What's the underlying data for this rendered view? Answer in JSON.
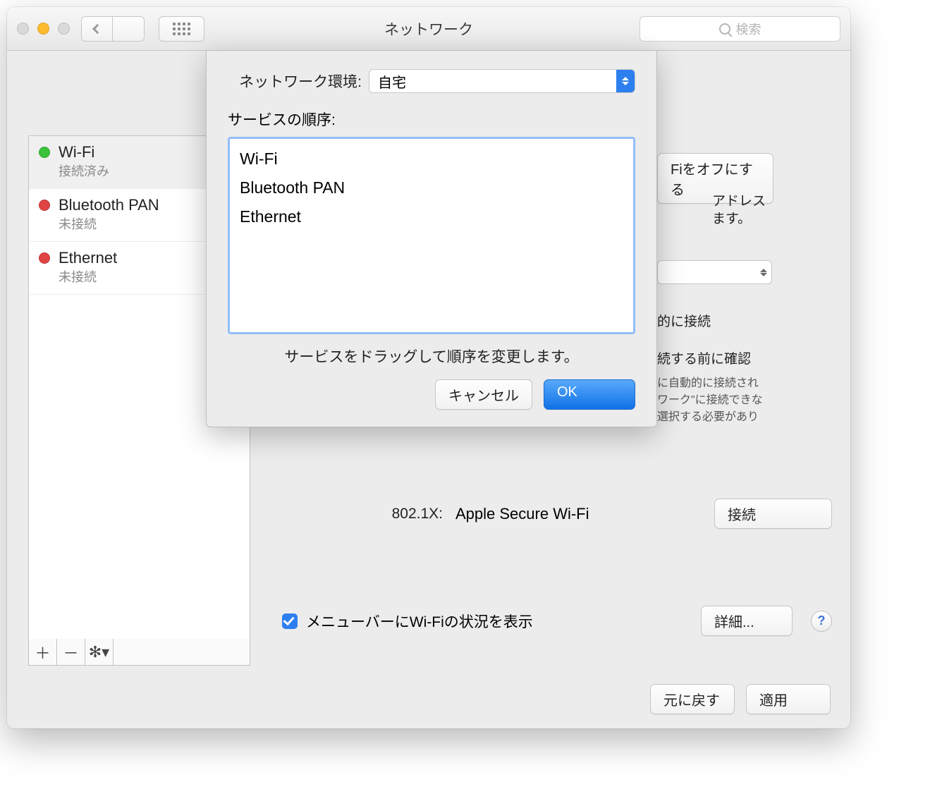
{
  "window": {
    "title": "ネットワーク",
    "search_placeholder": "検索"
  },
  "sidebar": {
    "items": [
      {
        "name": "Wi-Fi",
        "status": "接続済み",
        "led": "green"
      },
      {
        "name": "Bluetooth PAN",
        "status": "未接続",
        "led": "red"
      },
      {
        "name": "Ethernet",
        "status": "未接続",
        "led": "red"
      }
    ]
  },
  "sheet": {
    "location_label": "ネットワーク環境:",
    "location_value": "自宅",
    "order_label": "サービスの順序:",
    "service_order": [
      "Wi-Fi",
      "Bluetooth PAN",
      "Ethernet"
    ],
    "hint": "サービスをドラッグして順序を変更します。",
    "cancel": "キャンセル",
    "ok": "OK"
  },
  "main": {
    "wifi_off_button": "Fiをオフにする",
    "addr_frag": "アドレス",
    "masu": "ます。",
    "auto_connect": "的に接続",
    "confirm_before": "続する前に確認",
    "desc_1": "に自動的に接続され",
    "desc_2": "ワーク\"に接続できな",
    "desc_3": "選択する必要があり",
    "label_8021x": "802.1X:",
    "value_8021x": "Apple Secure Wi-Fi",
    "connect_button": "接続",
    "menubar_label": "メニューバーにWi-Fiの状況を表示",
    "advanced_button": "詳細...",
    "revert_button": "元に戻す",
    "apply_button": "適用"
  }
}
